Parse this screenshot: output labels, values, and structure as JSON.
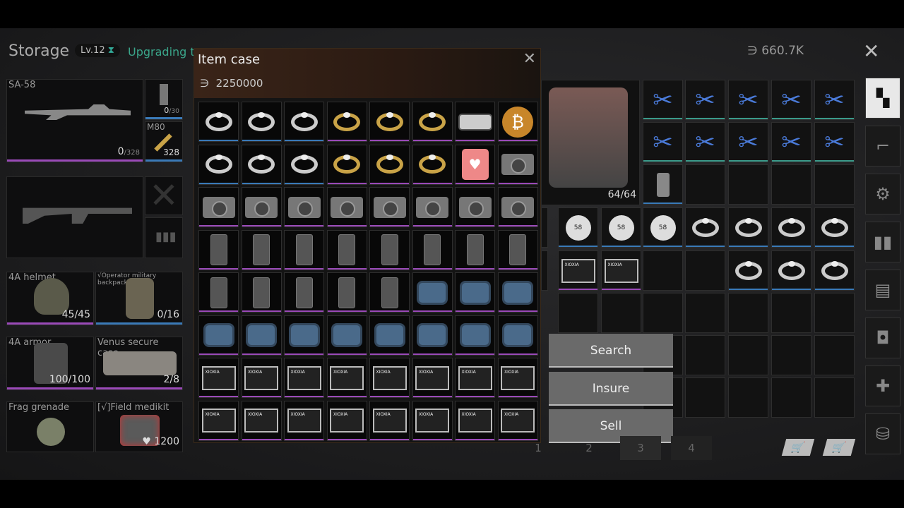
{
  "header": {
    "title": "Storage",
    "level": "Lv.12",
    "upgrade_text": "Upgrading to",
    "currency": "660.7K"
  },
  "loadout": {
    "primary": {
      "label": "SA-58",
      "ammo": "0",
      "ammo_max": "/328"
    },
    "mag": {
      "count": "0",
      "max": "/30"
    },
    "ammo_type": {
      "label": "M80",
      "count": "328"
    },
    "helmet": {
      "label": "4A helmet",
      "count": "45/45"
    },
    "backpack": {
      "label": "√Operator military backpack",
      "count": "0/16"
    },
    "armor": {
      "label": "4A armor",
      "count": "100/100"
    },
    "secure": {
      "label": "Venus secure case",
      "count": "2/8"
    },
    "grenade": {
      "label": "Frag grenade"
    },
    "medkit": {
      "label": "[√]Field medikit",
      "count": "1200"
    }
  },
  "item_case": {
    "title": "Item case",
    "price": "2250000",
    "grid": [
      [
        "ring-silver",
        "ring-silver",
        "ring-silver",
        "ring-gold",
        "ring-gold",
        "ring-gold",
        "console",
        "bitcoin"
      ],
      [
        "ring-silver",
        "ring-silver",
        "ring-silver",
        "ring-gold",
        "ring-gold",
        "ring-gold",
        "heart-box",
        "camera"
      ],
      [
        "camera",
        "camera",
        "camera",
        "camera",
        "camera",
        "camera",
        "camera",
        "camera"
      ],
      [
        "phone",
        "phone",
        "phone",
        "phone",
        "phone",
        "phone",
        "phone",
        "phone"
      ],
      [
        "phone",
        "phone",
        "phone",
        "phone",
        "phone",
        "watch",
        "watch",
        "watch"
      ],
      [
        "watch",
        "watch",
        "watch",
        "watch",
        "watch",
        "watch",
        "watch",
        "watch"
      ],
      [
        "ssd",
        "ssd",
        "ssd",
        "ssd",
        "ssd",
        "ssd",
        "ssd",
        "ssd"
      ],
      [
        "ssd",
        "ssd",
        "ssd",
        "ssd",
        "ssd",
        "ssd",
        "ssd",
        "ssd"
      ]
    ],
    "ssd_brand": "XIOXIA"
  },
  "container": {
    "count": "64/64"
  },
  "context_menu": [
    "Search",
    "Insure",
    "Sell"
  ],
  "pages": [
    "1",
    "2",
    "3",
    "4"
  ],
  "colors": {
    "accent": "#3aa58a",
    "purple": "#9a4ab8",
    "blue": "#3a7ab8"
  }
}
